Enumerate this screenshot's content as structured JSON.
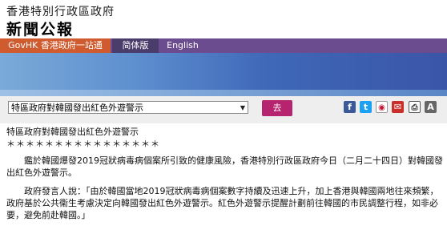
{
  "header": {
    "org_name": "香港特別行政區政府",
    "pub_name": "新聞公報"
  },
  "nav": {
    "home": "GovHK 香港政府一站通",
    "simplified": "简体版",
    "english": "English"
  },
  "toolbar": {
    "select_value": "特區政府對韓國發出紅色外遊警示",
    "go_label": "去",
    "icons": [
      "facebook-icon",
      "twitter-icon",
      "weibo-icon",
      "email-icon",
      "print-icon",
      "font-size-icon"
    ]
  },
  "article": {
    "title": "特區政府對韓國發出紅色外遊警示",
    "stars": "＊＊＊＊＊＊＊＊＊＊＊＊＊＊＊＊",
    "para1": "鑑於韓國爆發2019冠狀病毒病個案所引致的健康風險，香港特別行政區政府今日（二月二十四日）對韓國發出紅色外遊警示。",
    "para2": "政府發言人說：「由於韓國當地2019冠狀病毒病個案數字持續及迅速上升，加上香港與韓國兩地往來頻繁，政府基於公共衞生考慮決定向韓國發出紅色外遊警示。紅色外遊警示提醒計劃前往韓國的市民調整行程，如非必要，避免前赴韓國。」"
  },
  "colors": {
    "nav_bg": "#6b4c8f",
    "home_bg": "#cf5b2e",
    "go_button": "#b6236f",
    "banner": "#3f68b8"
  }
}
